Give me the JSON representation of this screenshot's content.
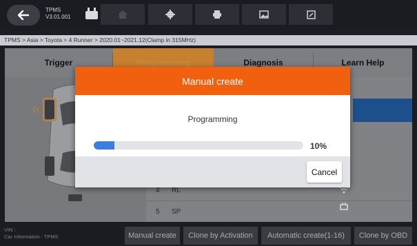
{
  "app": {
    "name": "TPMS",
    "version": "V3.01.001"
  },
  "toolbar": {
    "icons": [
      "back-icon",
      "home-icon",
      "gear-icon",
      "printer-icon",
      "image-icon",
      "edit-icon"
    ]
  },
  "breadcrumb": "TPMS > Asia > Toyota > 4 Runner > 2020.01~2021.12(Clamp in 315MHz)",
  "tabs": [
    {
      "label": "Trigger",
      "active": false
    },
    {
      "label": "Programming",
      "active": true
    },
    {
      "label": "Diagnosis",
      "active": false
    },
    {
      "label": "Learn Help",
      "active": false
    }
  ],
  "table": {
    "rows": [
      {
        "num": "4",
        "pos": "RL",
        "icon": "wifi-icon"
      },
      {
        "num": "5",
        "pos": "SP",
        "icon": "sensor-icon"
      }
    ]
  },
  "bottom": {
    "vin_label": "VIN :",
    "car_info": "Car Information : TPMS",
    "buttons": [
      "Manual create",
      "Clone by Activation",
      "Automatic create(1-16)",
      "Clone by OBD"
    ]
  },
  "dialog": {
    "title": "Manual create",
    "message": "Programming",
    "progress": 0.1,
    "progress_label": "10%",
    "cancel_label": "Cancel"
  },
  "colors": {
    "accent": "#f0600f",
    "progress": "#3a7ee0",
    "highlight": "#1c4f8c",
    "active_tab": "#c6802f"
  }
}
